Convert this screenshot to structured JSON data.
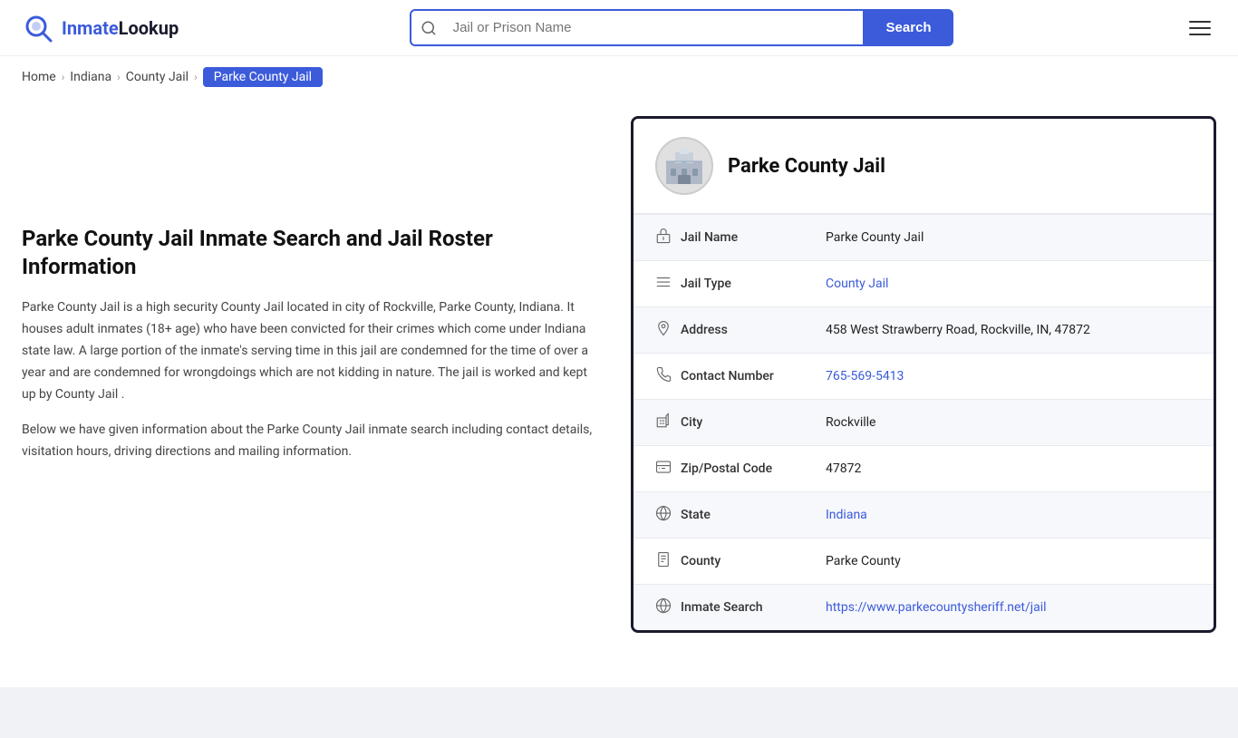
{
  "header": {
    "logo_brand": "InmateLookup",
    "logo_brand_highlight": "Inmate",
    "logo_brand_rest": "Lookup",
    "search_placeholder": "Jail or Prison Name",
    "search_button_label": "Search"
  },
  "breadcrumb": {
    "items": [
      {
        "label": "Home",
        "href": "#"
      },
      {
        "label": "Indiana",
        "href": "#"
      },
      {
        "label": "County Jail",
        "href": "#"
      },
      {
        "label": "Parke County Jail",
        "active": true
      }
    ]
  },
  "left": {
    "title": "Parke County Jail Inmate Search and Jail Roster Information",
    "description1": "Parke County Jail is a high security County Jail located in city of Rockville, Parke County, Indiana. It houses adult inmates (18+ age) who have been convicted for their crimes which come under Indiana state law. A large portion of the inmate's serving time in this jail are condemned for the time of over a year and are condemned for wrongdoings which are not kidding in nature. The jail is worked and kept up by County Jail .",
    "description2": "Below we have given information about the Parke County Jail inmate search including contact details, visitation hours, driving directions and mailing information."
  },
  "card": {
    "facility_name": "Parke County Jail",
    "rows": [
      {
        "icon": "jail-icon",
        "label": "Jail Name",
        "value": "Parke County Jail",
        "link": null
      },
      {
        "icon": "type-icon",
        "label": "Jail Type",
        "value": "County Jail",
        "link": "#"
      },
      {
        "icon": "location-icon",
        "label": "Address",
        "value": "458 West Strawberry Road, Rockville, IN, 47872",
        "link": null
      },
      {
        "icon": "phone-icon",
        "label": "Contact Number",
        "value": "765-569-5413",
        "link": "tel:765-569-5413"
      },
      {
        "icon": "city-icon",
        "label": "City",
        "value": "Rockville",
        "link": null
      },
      {
        "icon": "zip-icon",
        "label": "Zip/Postal Code",
        "value": "47872",
        "link": null
      },
      {
        "icon": "state-icon",
        "label": "State",
        "value": "Indiana",
        "link": "#"
      },
      {
        "icon": "county-icon",
        "label": "County",
        "value": "Parke County",
        "link": null
      },
      {
        "icon": "globe-icon",
        "label": "Inmate Search",
        "value": "https://www.parkecountysheriff.net/jail",
        "link": "https://www.parkecountysheriff.net/jail"
      }
    ]
  },
  "icons": {
    "jail-icon": "🏛",
    "type-icon": "☰",
    "location-icon": "📍",
    "phone-icon": "📞",
    "city-icon": "🏢",
    "zip-icon": "✉",
    "state-icon": "🌐",
    "county-icon": "🗂",
    "globe-icon": "🌐"
  }
}
